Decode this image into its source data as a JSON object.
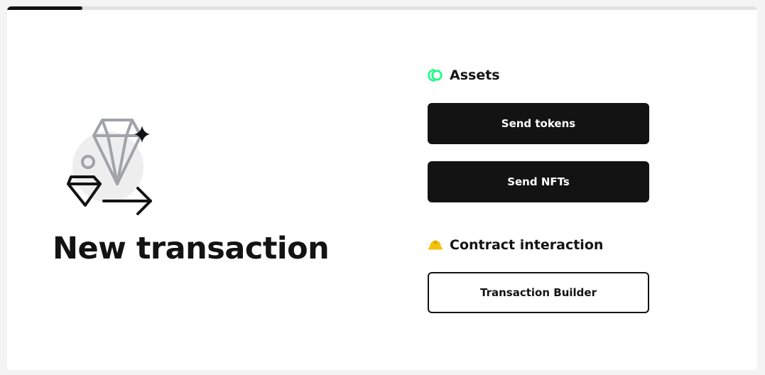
{
  "progress": {
    "fraction": 0.1,
    "fill_color": "#121312",
    "track_color": "#e2e2e2"
  },
  "title": "New transaction",
  "illustration": {
    "name": "diamond-transfer-illustration"
  },
  "assets": {
    "heading": "Assets",
    "icon": "assets-coins-icon",
    "icon_color": "#12ff80",
    "buttons": [
      {
        "label": "Send tokens"
      },
      {
        "label": "Send NFTs"
      }
    ]
  },
  "contract": {
    "heading": "Contract interaction",
    "icon": "hard-hat-icon",
    "icon_color": "#f4c20d",
    "buttons": [
      {
        "label": "Transaction Builder"
      }
    ]
  }
}
